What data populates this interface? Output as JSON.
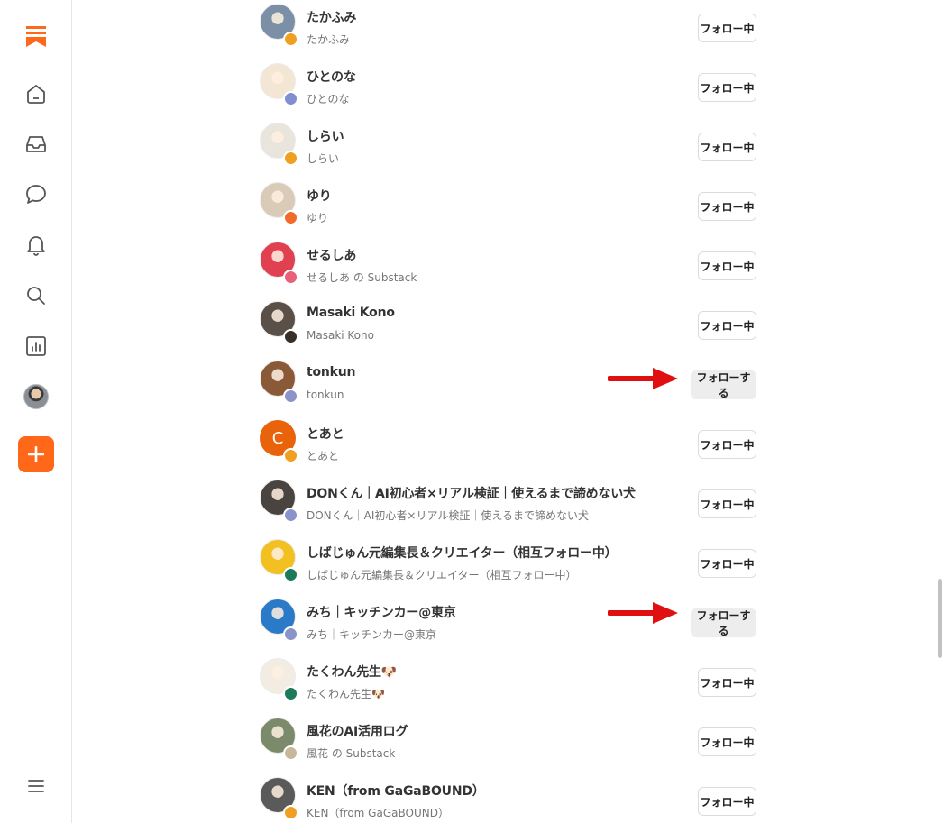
{
  "sidebar": {
    "items": [
      {
        "name": "home-icon"
      },
      {
        "name": "inbox-icon"
      },
      {
        "name": "chat-icon"
      },
      {
        "name": "bell-icon"
      },
      {
        "name": "search-icon"
      },
      {
        "name": "stats-icon"
      }
    ],
    "accent": "#ff6719"
  },
  "follow_labels": {
    "following": "フォロー中",
    "follow": "フォローする"
  },
  "people": [
    {
      "name": "たかふみ",
      "handle": "たかふみ",
      "state": "following",
      "badge": "#f0a020",
      "avatar": "#7b8fa6"
    },
    {
      "name": "ひとのな",
      "handle": "ひとのな",
      "state": "following",
      "badge": "#7f8fd0",
      "avatar": "#f3e6d4"
    },
    {
      "name": "しらい",
      "handle": "しらい",
      "state": "following",
      "badge": "#f0a020",
      "avatar": "#e9e4dc"
    },
    {
      "name": "ゆり",
      "handle": "ゆり",
      "state": "following",
      "badge": "#f06a2a",
      "avatar": "#d9cbb8"
    },
    {
      "name": "せるしあ",
      "handle": "せるしあ の Substack",
      "state": "following",
      "badge": "#e8607a",
      "avatar": "#e04050"
    },
    {
      "name": "Masaki Kono",
      "handle": "Masaki Kono",
      "state": "following",
      "badge": "#3a2e2a",
      "avatar": "#5a5048"
    },
    {
      "name": "tonkun",
      "handle": "tonkun",
      "state": "follow",
      "badge": "#8a94c8",
      "avatar": "#8a5a38"
    },
    {
      "name": "とあと",
      "handle": "とあと",
      "state": "following",
      "badge": "#f0a020",
      "avatar": "#e8630a",
      "initial": "C"
    },
    {
      "name": "DONくん｜AI初心者×リアル検証｜使えるまで諦めない犬",
      "handle": "DONくん｜AI初心者×リアル検証｜使えるまで諦めない犬",
      "state": "following",
      "badge": "#8a94c8",
      "avatar": "#4a4440"
    },
    {
      "name": "しばじゅん元編集長＆クリエイター（相互フォロー中）",
      "handle": "しばじゅん元編集長＆クリエイター（相互フォロー中）",
      "state": "following",
      "badge": "#1a7a5a",
      "avatar": "#f2c020"
    },
    {
      "name": "みち｜キッチンカー@東京",
      "handle": "みち｜キッチンカー@東京",
      "state": "follow",
      "badge": "#8a94c8",
      "avatar": "#2a7ac8"
    },
    {
      "name": "たくわん先生🐶",
      "handle": "たくわん先生🐶",
      "state": "following",
      "badge": "#1a7a5a",
      "avatar": "#f2ece2"
    },
    {
      "name": "風花のAI活用ログ",
      "handle": "風花 の Substack",
      "state": "following",
      "badge": "#c8b89a",
      "avatar": "#7a8a6a"
    },
    {
      "name": "KEN（from GaGaBOUND）",
      "handle": "KEN（from GaGaBOUND）",
      "state": "following",
      "badge": "#f0a020",
      "avatar": "#5a5a5a"
    }
  ],
  "annotations": {
    "arrow_color": "#e01010"
  }
}
